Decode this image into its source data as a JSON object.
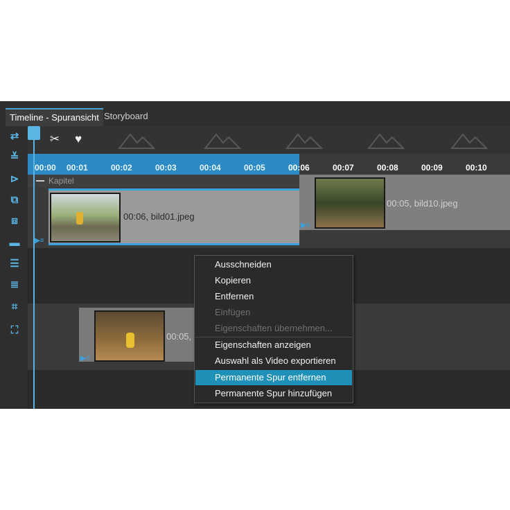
{
  "tabs": {
    "timeline": "Timeline - Spuransicht",
    "storyboard": "Storyboard"
  },
  "ruler": {
    "ticks": [
      "00:00",
      "00:01",
      "00:02",
      "00:03",
      "00:04",
      "00:05",
      "00:06",
      "00:07",
      "00:08",
      "00:09",
      "00:10"
    ]
  },
  "chapter": {
    "label": "Kapitel"
  },
  "clips": [
    {
      "label": "00:06, bild01.jpeg"
    },
    {
      "label": "00:05, bild10.jpeg"
    },
    {
      "label": "00:05,"
    }
  ],
  "context_menu": {
    "items": [
      {
        "label": "Ausschneiden",
        "enabled": true
      },
      {
        "label": "Kopieren",
        "enabled": true
      },
      {
        "label": "Entfernen",
        "enabled": true
      },
      {
        "label": "Einfügen",
        "enabled": false
      },
      {
        "label": "Eigenschaften übernehmen...",
        "enabled": false
      },
      {
        "label": "Eigenschaften anzeigen",
        "enabled": true
      },
      {
        "label": "Auswahl als Video exportieren",
        "enabled": true
      },
      {
        "label": "Permanente Spur entfernen",
        "enabled": true,
        "highlighted": true
      },
      {
        "label": "Permanente Spur hinzufügen",
        "enabled": true
      }
    ]
  },
  "colors": {
    "accent": "#2c8ac4",
    "highlight": "#1f90b8",
    "background": "#2b2b2b"
  }
}
